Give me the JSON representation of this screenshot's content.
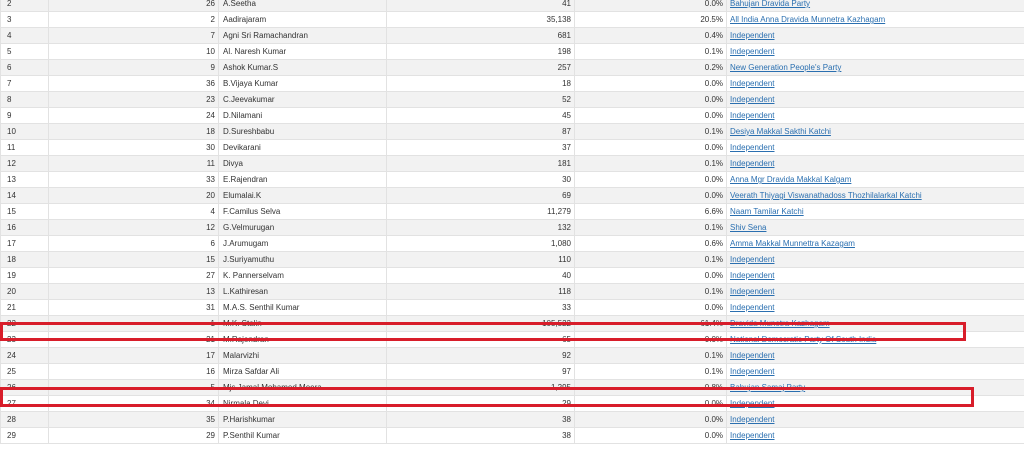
{
  "results_table": {
    "rows": [
      {
        "rank": "2",
        "serial": "26",
        "candidate": "A.Seetha",
        "votes": "41",
        "share": "0.0%",
        "party": "Bahujan Dravida Party"
      },
      {
        "rank": "3",
        "serial": "2",
        "candidate": "Aadirajaram",
        "votes": "35,138",
        "share": "20.5%",
        "party": "All India Anna Dravida Munnetra Kazhagam"
      },
      {
        "rank": "4",
        "serial": "7",
        "candidate": "Agni Sri Ramachandran",
        "votes": "681",
        "share": "0.4%",
        "party": "Independent"
      },
      {
        "rank": "5",
        "serial": "10",
        "candidate": "Al. Naresh Kumar",
        "votes": "198",
        "share": "0.1%",
        "party": "Independent"
      },
      {
        "rank": "6",
        "serial": "9",
        "candidate": "Ashok Kumar.S",
        "votes": "257",
        "share": "0.2%",
        "party": "New Generation People's Party"
      },
      {
        "rank": "7",
        "serial": "36",
        "candidate": "B.Vijaya Kumar",
        "votes": "18",
        "share": "0.0%",
        "party": "Independent"
      },
      {
        "rank": "8",
        "serial": "23",
        "candidate": "C.Jeevakumar",
        "votes": "52",
        "share": "0.0%",
        "party": "Independent"
      },
      {
        "rank": "9",
        "serial": "24",
        "candidate": "D.Nilamani",
        "votes": "45",
        "share": "0.0%",
        "party": "Independent"
      },
      {
        "rank": "10",
        "serial": "18",
        "candidate": "D.Sureshbabu",
        "votes": "87",
        "share": "0.1%",
        "party": "Desiya Makkal Sakthi Katchi"
      },
      {
        "rank": "11",
        "serial": "30",
        "candidate": "Devikarani",
        "votes": "37",
        "share": "0.0%",
        "party": "Independent"
      },
      {
        "rank": "12",
        "serial": "11",
        "candidate": "Divya",
        "votes": "181",
        "share": "0.1%",
        "party": "Independent"
      },
      {
        "rank": "13",
        "serial": "33",
        "candidate": "E.Rajendran",
        "votes": "30",
        "share": "0.0%",
        "party": "Anna Mgr Dravida Makkal Kalgam"
      },
      {
        "rank": "14",
        "serial": "20",
        "candidate": "Elumalai.K",
        "votes": "69",
        "share": "0.0%",
        "party": "Veerath Thiyagi Viswanathadoss Thozhilalarkal Katchi"
      },
      {
        "rank": "15",
        "serial": "4",
        "candidate": "F.Camilus Selva",
        "votes": "11,279",
        "share": "6.6%",
        "party": "Naam Tamilar Katchi"
      },
      {
        "rank": "16",
        "serial": "12",
        "candidate": "G.Velmurugan",
        "votes": "132",
        "share": "0.1%",
        "party": "Shiv Sena"
      },
      {
        "rank": "17",
        "serial": "6",
        "candidate": "J.Arumugam",
        "votes": "1,080",
        "share": "0.6%",
        "party": "Amma Makkal Munnettra Kazagam"
      },
      {
        "rank": "18",
        "serial": "15",
        "candidate": "J.Suriyamuthu",
        "votes": "110",
        "share": "0.1%",
        "party": "Independent"
      },
      {
        "rank": "19",
        "serial": "27",
        "candidate": "K. Pannerselvam",
        "votes": "40",
        "share": "0.0%",
        "party": "Independent"
      },
      {
        "rank": "20",
        "serial": "13",
        "candidate": "L.Kathiresan",
        "votes": "118",
        "share": "0.1%",
        "party": "Independent"
      },
      {
        "rank": "21",
        "serial": "31",
        "candidate": "M.A.S. Senthil Kumar",
        "votes": "33",
        "share": "0.0%",
        "party": "Independent"
      },
      {
        "rank": "22",
        "serial": "1",
        "candidate": "M.K. Stalin",
        "votes": "105,522",
        "share": "61.4%",
        "party": "Dravida Munetra Kazhagam"
      },
      {
        "rank": "23",
        "serial": "21",
        "candidate": "M.Rajendran",
        "votes": "65",
        "share": "0.0%",
        "party": "National Democratic Party Of South India"
      },
      {
        "rank": "24",
        "serial": "17",
        "candidate": "Malarvizhi",
        "votes": "92",
        "share": "0.1%",
        "party": "Independent"
      },
      {
        "rank": "25",
        "serial": "16",
        "candidate": "Mirza Safdar Ali",
        "votes": "97",
        "share": "0.1%",
        "party": "Independent"
      },
      {
        "rank": "26",
        "serial": "5",
        "candidate": "Mjs.Jamal Mohamed Meera",
        "votes": "1,295",
        "share": "0.8%",
        "party": "Bahujan Samaj Party"
      },
      {
        "rank": "27",
        "serial": "34",
        "candidate": "Nirmala Devi",
        "votes": "29",
        "share": "0.0%",
        "party": "Independent"
      },
      {
        "rank": "28",
        "serial": "35",
        "candidate": "P.Harishkumar",
        "votes": "38",
        "share": "0.0%",
        "party": "Independent"
      },
      {
        "rank": "29",
        "serial": "29",
        "candidate": "P.Senthil Kumar",
        "votes": "38",
        "share": "0.0%",
        "party": "Independent"
      }
    ]
  },
  "highlight_color": "#d81d2a"
}
